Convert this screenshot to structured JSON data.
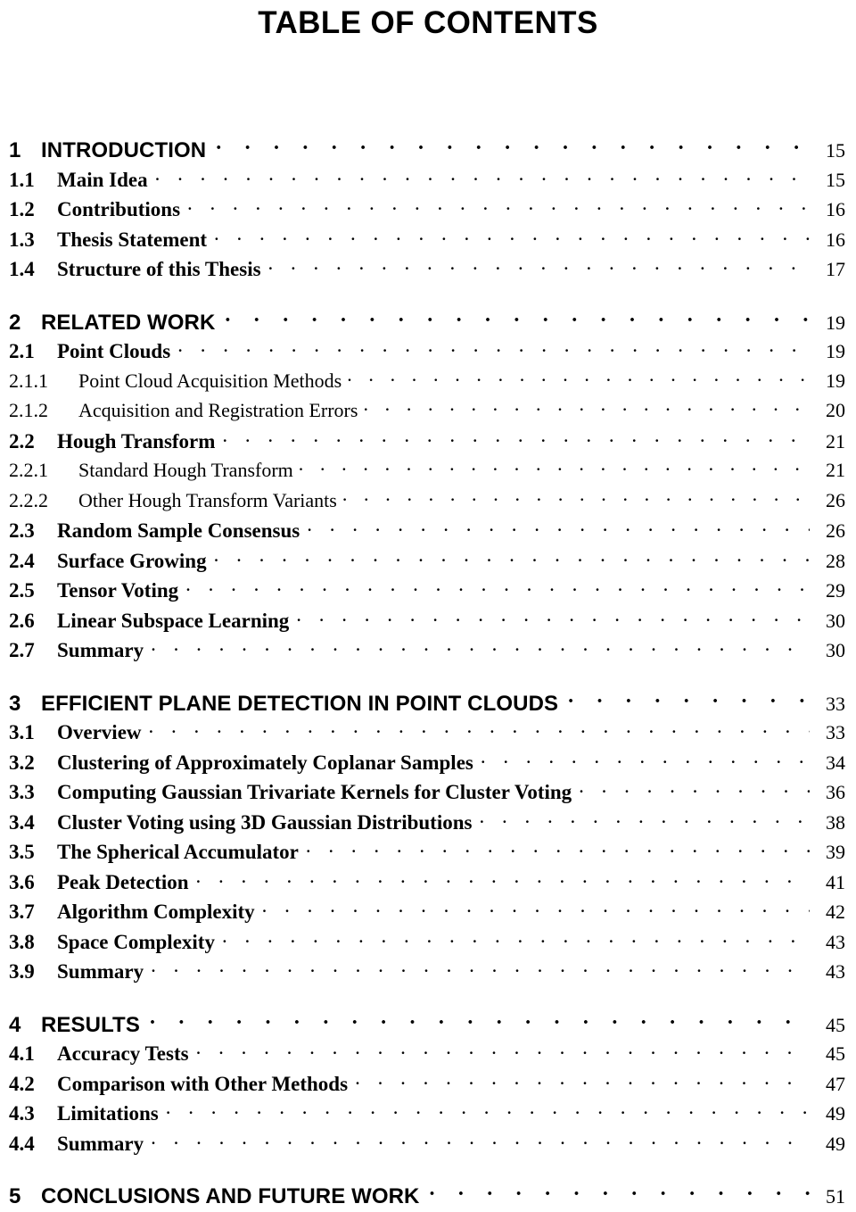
{
  "document": {
    "title": "TABLE OF CONTENTS"
  },
  "toc": {
    "entries": [
      {
        "level": "chapter",
        "number": "1",
        "label": "INTRODUCTION",
        "page": "15"
      },
      {
        "level": "section",
        "number": "1.1",
        "label": "Main Idea",
        "page": "15"
      },
      {
        "level": "section",
        "number": "1.2",
        "label": "Contributions",
        "page": "16"
      },
      {
        "level": "section",
        "number": "1.3",
        "label": "Thesis Statement",
        "page": "16"
      },
      {
        "level": "section",
        "number": "1.4",
        "label": "Structure of this Thesis",
        "page": "17"
      },
      {
        "level": "chapter",
        "number": "2",
        "label": "RELATED WORK",
        "page": "19"
      },
      {
        "level": "section",
        "number": "2.1",
        "label": "Point Clouds",
        "page": "19"
      },
      {
        "level": "subsection",
        "number": "2.1.1",
        "label": "Point Cloud Acquisition Methods",
        "page": "19"
      },
      {
        "level": "subsection",
        "number": "2.1.2",
        "label": "Acquisition and Registration Errors",
        "page": "20"
      },
      {
        "level": "section",
        "number": "2.2",
        "label": "Hough Transform",
        "page": "21"
      },
      {
        "level": "subsection",
        "number": "2.2.1",
        "label": "Standard Hough Transform",
        "page": "21"
      },
      {
        "level": "subsection",
        "number": "2.2.2",
        "label": "Other Hough Transform Variants",
        "page": "26"
      },
      {
        "level": "section",
        "number": "2.3",
        "label": "Random Sample Consensus",
        "page": "26"
      },
      {
        "level": "section",
        "number": "2.4",
        "label": "Surface Growing",
        "page": "28"
      },
      {
        "level": "section",
        "number": "2.5",
        "label": "Tensor Voting",
        "page": "29"
      },
      {
        "level": "section",
        "number": "2.6",
        "label": "Linear Subspace Learning",
        "page": "30"
      },
      {
        "level": "section",
        "number": "2.7",
        "label": "Summary",
        "page": "30"
      },
      {
        "level": "chapter",
        "number": "3",
        "label": "EFFICIENT PLANE DETECTION IN POINT CLOUDS",
        "page": "33"
      },
      {
        "level": "section",
        "number": "3.1",
        "label": "Overview",
        "page": "33"
      },
      {
        "level": "section",
        "number": "3.2",
        "label": "Clustering of Approximately Coplanar Samples",
        "page": "34"
      },
      {
        "level": "section",
        "number": "3.3",
        "label": "Computing Gaussian Trivariate Kernels for Cluster Voting",
        "page": "36"
      },
      {
        "level": "section",
        "number": "3.4",
        "label": "Cluster Voting using 3D Gaussian Distributions",
        "page": "38"
      },
      {
        "level": "section",
        "number": "3.5",
        "label": "The Spherical Accumulator",
        "page": "39"
      },
      {
        "level": "section",
        "number": "3.6",
        "label": "Peak Detection",
        "page": "41"
      },
      {
        "level": "section",
        "number": "3.7",
        "label": "Algorithm Complexity",
        "page": "42"
      },
      {
        "level": "section",
        "number": "3.8",
        "label": "Space Complexity",
        "page": "43"
      },
      {
        "level": "section",
        "number": "3.9",
        "label": "Summary",
        "page": "43"
      },
      {
        "level": "chapter",
        "number": "4",
        "label": "RESULTS",
        "page": "45"
      },
      {
        "level": "section",
        "number": "4.1",
        "label": "Accuracy Tests",
        "page": "45"
      },
      {
        "level": "section",
        "number": "4.2",
        "label": "Comparison with Other Methods",
        "page": "47"
      },
      {
        "level": "section",
        "number": "4.3",
        "label": "Limitations",
        "page": "49"
      },
      {
        "level": "section",
        "number": "4.4",
        "label": "Summary",
        "page": "49"
      },
      {
        "level": "chapter",
        "number": "5",
        "label": "CONCLUSIONS AND FUTURE WORK",
        "page": "51"
      }
    ]
  }
}
